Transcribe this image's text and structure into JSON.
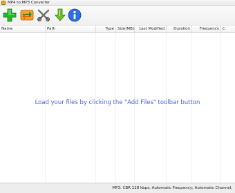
{
  "window": {
    "title": "MP4 to MP3 Converter"
  },
  "toolbar": {
    "buttons": [
      {
        "name": "add-files",
        "icon": "plus-icon",
        "color": "#1fae1f"
      },
      {
        "name": "convert",
        "icon": "refresh-arrows-icon",
        "color": "#e27a12"
      },
      {
        "name": "remove",
        "icon": "scissors-x-icon",
        "color": "#7a7a7a"
      },
      {
        "name": "download",
        "icon": "down-arrow-icon",
        "color": "#5aa51b"
      },
      {
        "name": "about",
        "icon": "info-icon",
        "color": "#2563d9"
      }
    ]
  },
  "table": {
    "columns": [
      "Name",
      "Path",
      "Type",
      "Size(MB)",
      "Last Modified",
      "Duration",
      "Frequency",
      "C"
    ],
    "rows": []
  },
  "empty_hint": "Load your files by clicking the \"Add Files\" toolbar button",
  "statusbar": {
    "text": "MP3:  CBR 128 kbps; Automatic Frequency; Automatic Channel;"
  }
}
